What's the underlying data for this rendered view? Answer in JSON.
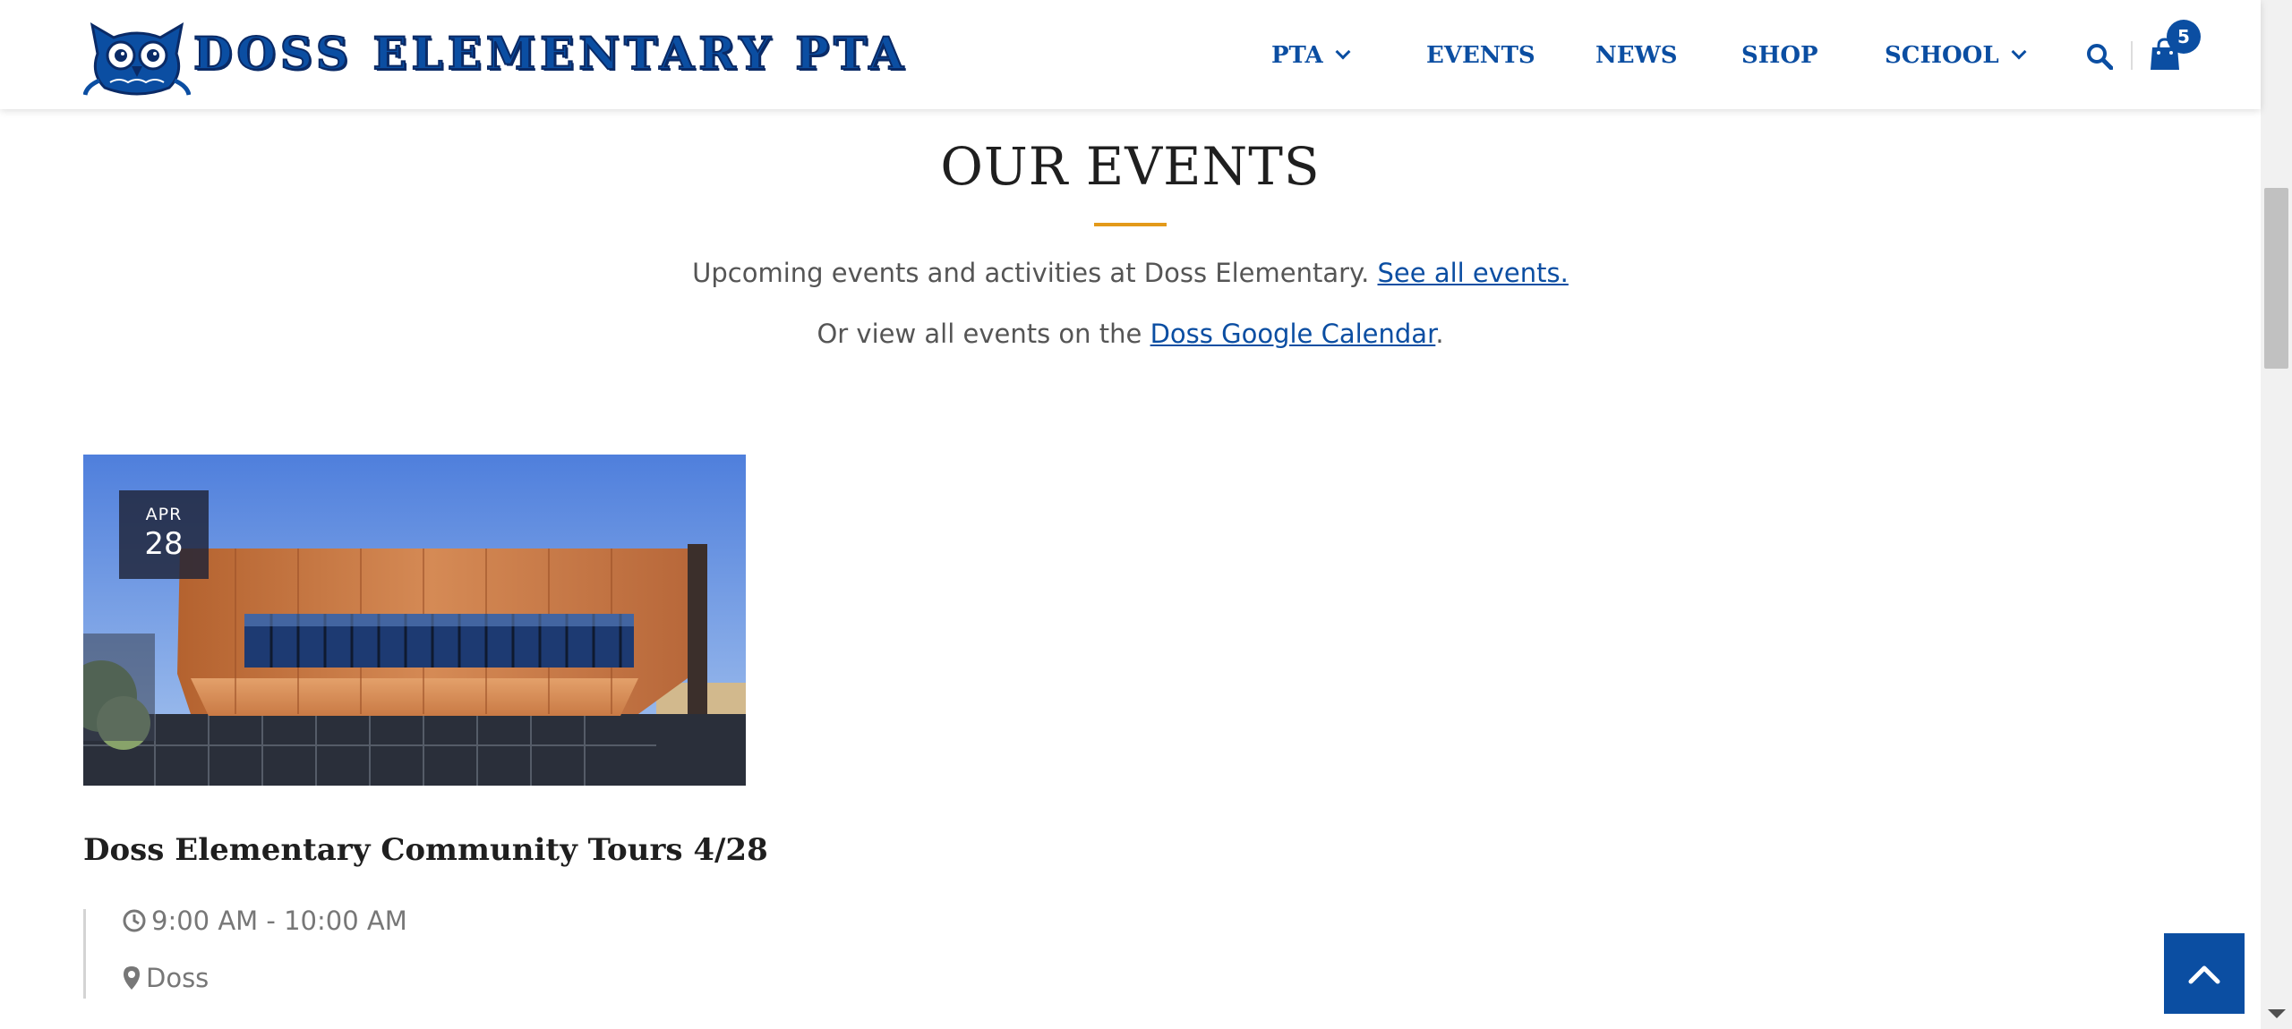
{
  "header": {
    "logo_text": "DOSS ELEMENTARY PTA",
    "nav": [
      {
        "label": "PTA",
        "has_dropdown": true
      },
      {
        "label": "EVENTS",
        "has_dropdown": false
      },
      {
        "label": "NEWS",
        "has_dropdown": false
      },
      {
        "label": "SHOP",
        "has_dropdown": false
      },
      {
        "label": "SCHOOL",
        "has_dropdown": true
      }
    ],
    "search_icon": "search-icon",
    "cart_icon": "shopping-bag-icon",
    "cart_count": "5"
  },
  "section": {
    "title": "OUR EVENTS",
    "intro_text": "Upcoming events and activities at Doss Elementary. ",
    "intro_link": "See all events.",
    "calendar_prefix": "Or view all events on the ",
    "calendar_link": "Doss Google Calendar",
    "calendar_suffix": "."
  },
  "event": {
    "month": "APR",
    "day": "28",
    "title": "Doss Elementary Community Tours 4/28",
    "time": "9:00 AM - 10:00 AM",
    "location": "Doss",
    "time_icon": "clock-icon",
    "location_icon": "map-pin-icon"
  },
  "colors": {
    "brand_blue": "#0b4ea2",
    "accent_orange": "#e39a1a",
    "heading": "#1f1f1f"
  },
  "back_to_top_icon": "chevron-up-icon"
}
